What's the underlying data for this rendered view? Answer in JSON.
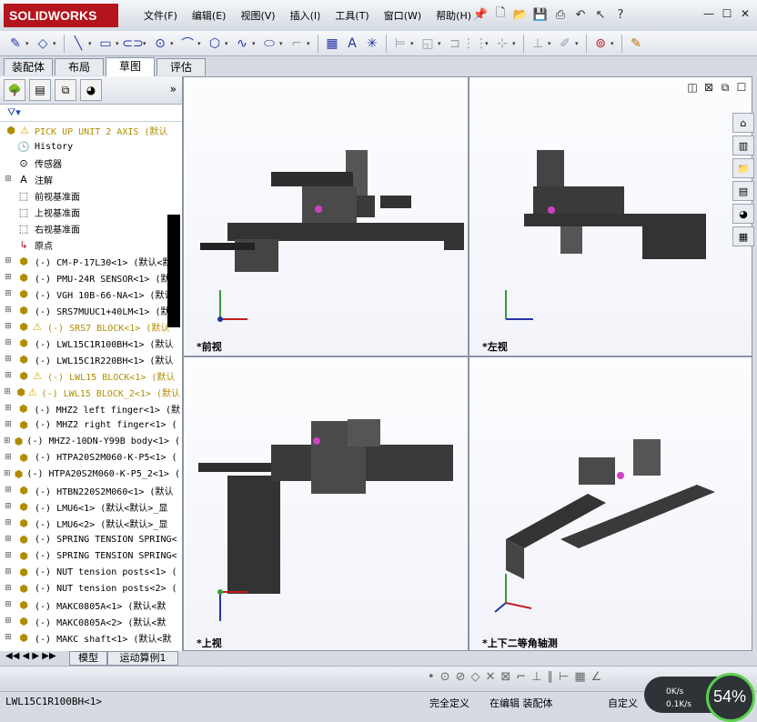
{
  "app": {
    "logo": "SOLIDWORKS"
  },
  "menu": [
    "文件(F)",
    "编辑(E)",
    "视图(V)",
    "插入(I)",
    "工具(T)",
    "窗口(W)",
    "帮助(H)"
  ],
  "tabs": [
    "装配体",
    "布局",
    "草图",
    "评估"
  ],
  "active_tab": "草图",
  "filter_icon": "filter-icon",
  "tree": {
    "root": "PICK UP UNIT 2 AXIS  (默认",
    "history": "History",
    "sensors": "传感器",
    "annotations": "注解",
    "front_plane": "前视基准面",
    "top_plane": "上视基准面",
    "right_plane": "右视基准面",
    "origin": "原点",
    "components": [
      {
        "label": "(-) CM-P-17L30<1> (默认<默",
        "warn": false
      },
      {
        "label": "(-) PMU-24R SENSOR<1> (默认",
        "warn": false
      },
      {
        "label": "(-) VGH 10B-66-NA<1> (默认",
        "warn": false
      },
      {
        "label": "(-) SRS7MUUC1+40LM<1> (默认",
        "warn": false
      },
      {
        "label": "(-) SRS7 BLOCK<1>  (默认",
        "warn": true
      },
      {
        "label": "(-) LWL15C1R100BH<1> (默认",
        "warn": false
      },
      {
        "label": "(-) LWL15C1R220BH<1> (默认",
        "warn": false
      },
      {
        "label": "(-) LWL15 BLOCK<1>  (默认",
        "warn": true
      },
      {
        "label": "(-) LWL15 BLOCK_2<1>  (默认",
        "warn": true
      },
      {
        "label": "(-) MHZ2 left finger<1> (默",
        "warn": false
      },
      {
        "label": "(-) MHZ2 right finger<1> (",
        "warn": false
      },
      {
        "label": "(-) MHZ2-10DN-Y99B body<1> (",
        "warn": false
      },
      {
        "label": "(-) HTPA20S2M060-K-P5<1> (",
        "warn": false
      },
      {
        "label": "(-) HTPA20S2M060-K-P5_2<1> (",
        "warn": false
      },
      {
        "label": "(-) HTBN220S2M060<1> (默认",
        "warn": false
      },
      {
        "label": "(-) LMU6<1> (默认<默认>_显",
        "warn": false
      },
      {
        "label": "(-) LMU6<2> (默认<默认>_显",
        "warn": false
      },
      {
        "label": "(-) SPRING TENSION SPRING<",
        "warn": false
      },
      {
        "label": "(-) SPRING TENSION SPRING<",
        "warn": false
      },
      {
        "label": "(-) NUT tension posts<1> (",
        "warn": false
      },
      {
        "label": "(-) NUT tension posts<2> (",
        "warn": false
      },
      {
        "label": "(-) MAKC0805A<1> (默认<默",
        "warn": false
      },
      {
        "label": "(-) MAKC0805A<2> (默认<默",
        "warn": false
      },
      {
        "label": "(-) MAKC shaft<1> (默认<默",
        "warn": false
      }
    ]
  },
  "bottom_tabs": [
    "模型",
    "运动算例1"
  ],
  "views": {
    "front": "*前视",
    "left": "*左视",
    "top": "*上视",
    "iso": "*上下二等角轴测"
  },
  "status": {
    "selection": "LWL15C1R100BH<1>",
    "state": "完全定义",
    "mode": "在编辑 装配体",
    "custom": "自定义",
    "speed": "0K/s",
    "speed2": "0.1K/s",
    "percent": "54%"
  },
  "colors": {
    "brand": "#b4141d",
    "accent": "#2a5db0",
    "warn": "#f2c400"
  }
}
